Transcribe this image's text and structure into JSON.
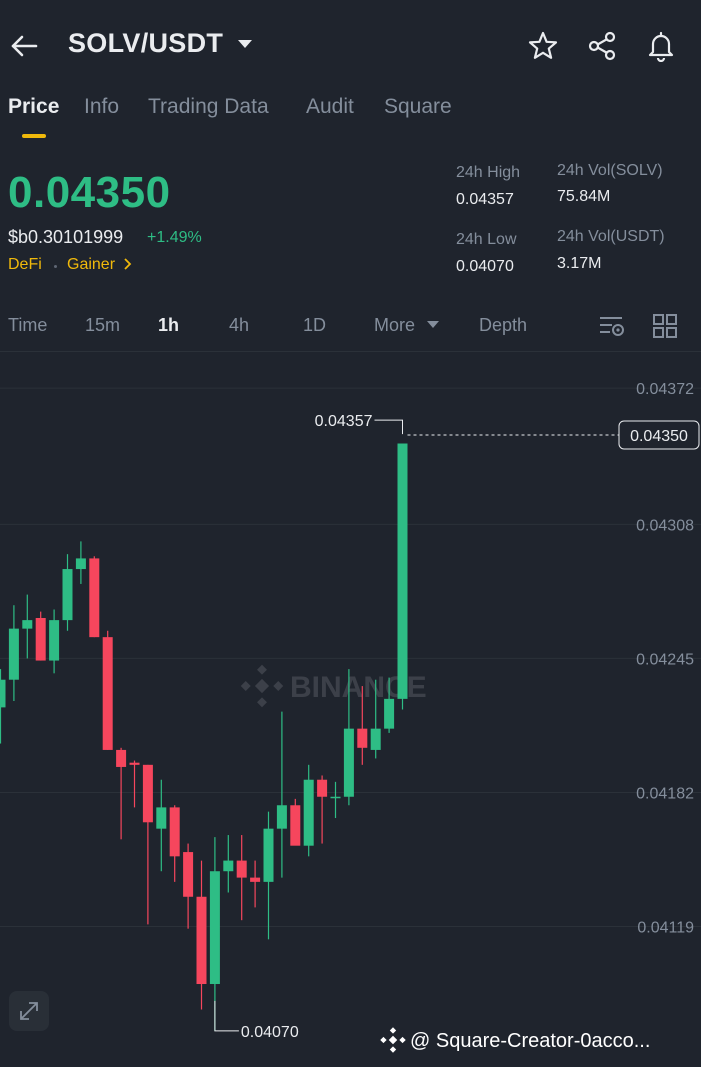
{
  "header": {
    "pair": "SOLV/USDT",
    "icons": [
      "back-arrow-icon",
      "star-icon",
      "share-icon",
      "bell-icon"
    ]
  },
  "tabs": [
    "Price",
    "Info",
    "Trading Data",
    "Audit",
    "Square"
  ],
  "active_tab": "Price",
  "price": {
    "last": "0.04350",
    "fiat": "$b0.30101999",
    "change": "+1.49%",
    "tag_category": "DeFi",
    "tag_rank": "Gainer"
  },
  "stats": {
    "high_label": "24h High",
    "high_value": "0.04357",
    "low_label": "24h Low",
    "low_value": "0.04070",
    "vol_base_label": "24h Vol(SOLV)",
    "vol_base_value": "75.84M",
    "vol_quote_label": "24h Vol(USDT)",
    "vol_quote_value": "3.17M"
  },
  "intervals": [
    "Time",
    "15m",
    "1h",
    "4h",
    "1D",
    "More",
    "Depth"
  ],
  "active_interval": "1h",
  "colors": {
    "up": "#2ebd85",
    "down": "#f6465d",
    "accent": "#f0b90b",
    "background": "#1f242d"
  },
  "chart_data": {
    "type": "candlestick",
    "interval": "1h",
    "y_ticks": [
      "0.04372",
      "0.04308",
      "0.04245",
      "0.04182",
      "0.04119"
    ],
    "ylim": [
      0.04053,
      0.04389
    ],
    "last_price": "0.04350",
    "high_marker": "0.04357",
    "low_marker": "0.04070",
    "candles": [
      {
        "o": 0.04222,
        "h": 0.0424,
        "l": 0.04205,
        "c": 0.04235
      },
      {
        "o": 0.04235,
        "h": 0.0427,
        "l": 0.04225,
        "c": 0.04259
      },
      {
        "o": 0.04259,
        "h": 0.04275,
        "l": 0.04245,
        "c": 0.04263
      },
      {
        "o": 0.04264,
        "h": 0.04267,
        "l": 0.04244,
        "c": 0.04244
      },
      {
        "o": 0.04244,
        "h": 0.04268,
        "l": 0.04238,
        "c": 0.04263
      },
      {
        "o": 0.04263,
        "h": 0.04294,
        "l": 0.04258,
        "c": 0.04287
      },
      {
        "o": 0.04287,
        "h": 0.043,
        "l": 0.0428,
        "c": 0.04292
      },
      {
        "o": 0.04292,
        "h": 0.04293,
        "l": 0.04255,
        "c": 0.04255
      },
      {
        "o": 0.04255,
        "h": 0.04258,
        "l": 0.04202,
        "c": 0.04202
      },
      {
        "o": 0.04202,
        "h": 0.04203,
        "l": 0.0416,
        "c": 0.04194
      },
      {
        "o": 0.04196,
        "h": 0.04197,
        "l": 0.04175,
        "c": 0.04195
      },
      {
        "o": 0.04195,
        "h": 0.04195,
        "l": 0.0412,
        "c": 0.04168
      },
      {
        "o": 0.04165,
        "h": 0.04188,
        "l": 0.04145,
        "c": 0.04175
      },
      {
        "o": 0.04175,
        "h": 0.04176,
        "l": 0.0414,
        "c": 0.04152
      },
      {
        "o": 0.04154,
        "h": 0.04158,
        "l": 0.04118,
        "c": 0.04133
      },
      {
        "o": 0.04133,
        "h": 0.0415,
        "l": 0.0408,
        "c": 0.04092
      },
      {
        "o": 0.04092,
        "h": 0.04161,
        "l": 0.0407,
        "c": 0.04145
      },
      {
        "o": 0.04145,
        "h": 0.04162,
        "l": 0.04135,
        "c": 0.0415
      },
      {
        "o": 0.0415,
        "h": 0.04162,
        "l": 0.04122,
        "c": 0.04142
      },
      {
        "o": 0.04142,
        "h": 0.0415,
        "l": 0.04128,
        "c": 0.0414
      },
      {
        "o": 0.0414,
        "h": 0.04173,
        "l": 0.04113,
        "c": 0.04165
      },
      {
        "o": 0.04165,
        "h": 0.0422,
        "l": 0.04142,
        "c": 0.04176
      },
      {
        "o": 0.04176,
        "h": 0.04179,
        "l": 0.04158,
        "c": 0.04157
      },
      {
        "o": 0.04157,
        "h": 0.04195,
        "l": 0.04152,
        "c": 0.04188
      },
      {
        "o": 0.04188,
        "h": 0.0419,
        "l": 0.04158,
        "c": 0.0418
      },
      {
        "o": 0.0418,
        "h": 0.04187,
        "l": 0.0417,
        "c": 0.0418
      },
      {
        "o": 0.0418,
        "h": 0.0424,
        "l": 0.04176,
        "c": 0.04212
      },
      {
        "o": 0.04212,
        "h": 0.04232,
        "l": 0.04195,
        "c": 0.04203
      },
      {
        "o": 0.04202,
        "h": 0.04235,
        "l": 0.04198,
        "c": 0.04212
      },
      {
        "o": 0.04212,
        "h": 0.04236,
        "l": 0.0421,
        "c": 0.04226
      },
      {
        "o": 0.04226,
        "h": 0.04346,
        "l": 0.04221,
        "c": 0.04346
      }
    ]
  },
  "footer": {
    "watermark": "BINANCE",
    "credit": "@ Square-Creator-0acco..."
  }
}
